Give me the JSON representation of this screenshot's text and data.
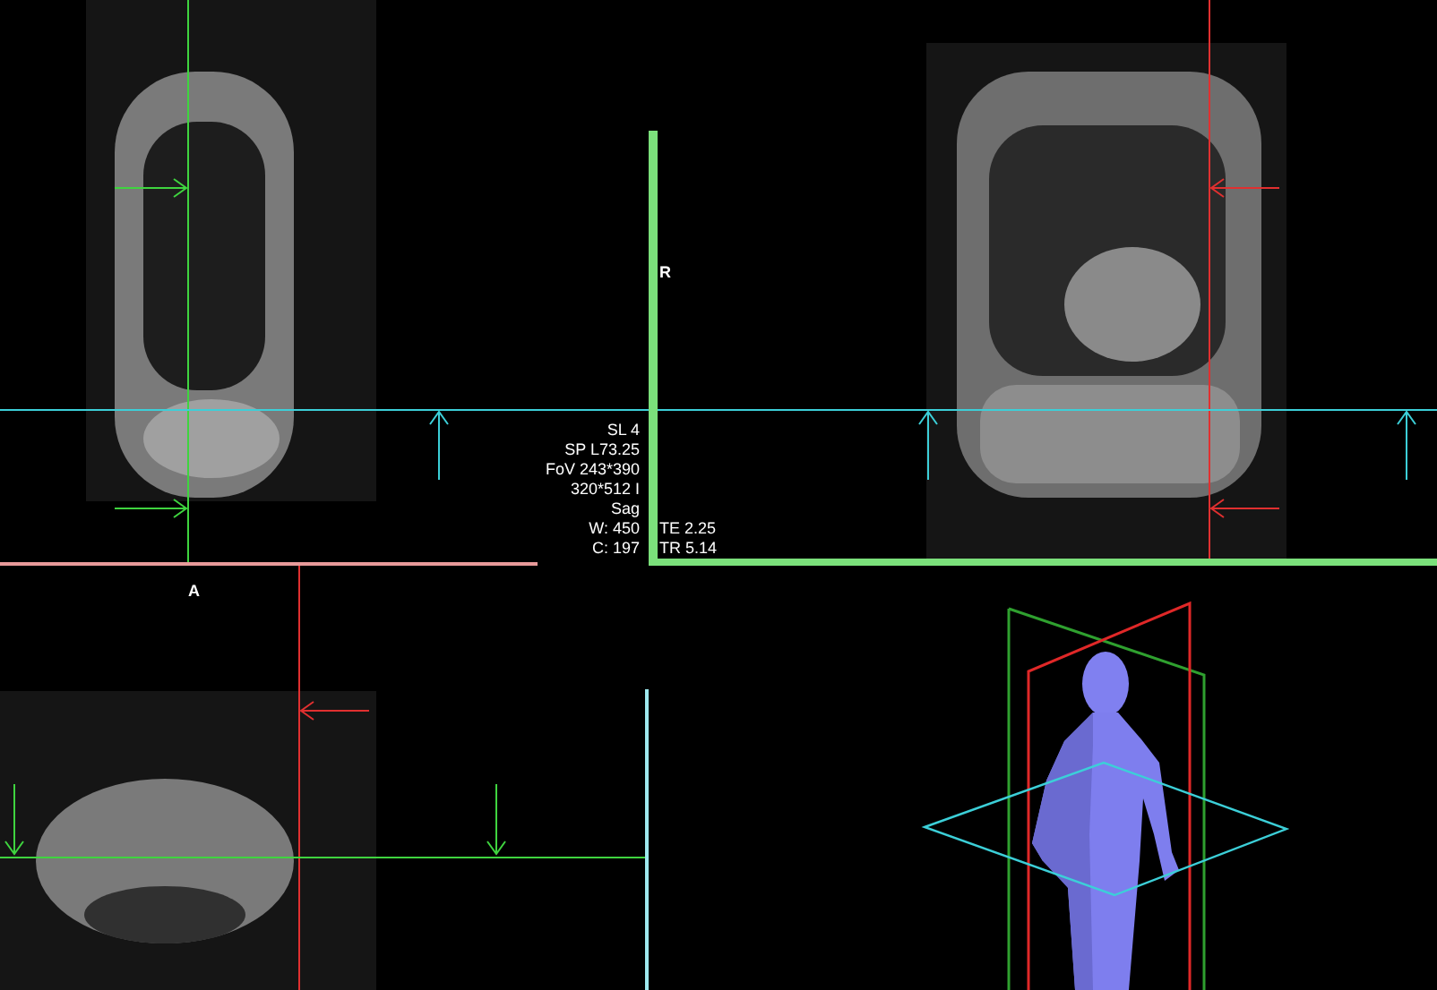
{
  "viewports": [
    {
      "kind": "sagittal",
      "info": [
        "SL 4",
        "SP L73.25",
        "FoV 243*390",
        "320*512 I",
        "Sag",
        "W: 450",
        "C: 197"
      ]
    },
    {
      "kind": "coronal",
      "orientation_label": "R",
      "info": [
        "TE 2.25",
        "TR 5.14"
      ]
    },
    {
      "kind": "axial",
      "orientation_label": "A"
    },
    {
      "kind": "model3d"
    }
  ]
}
